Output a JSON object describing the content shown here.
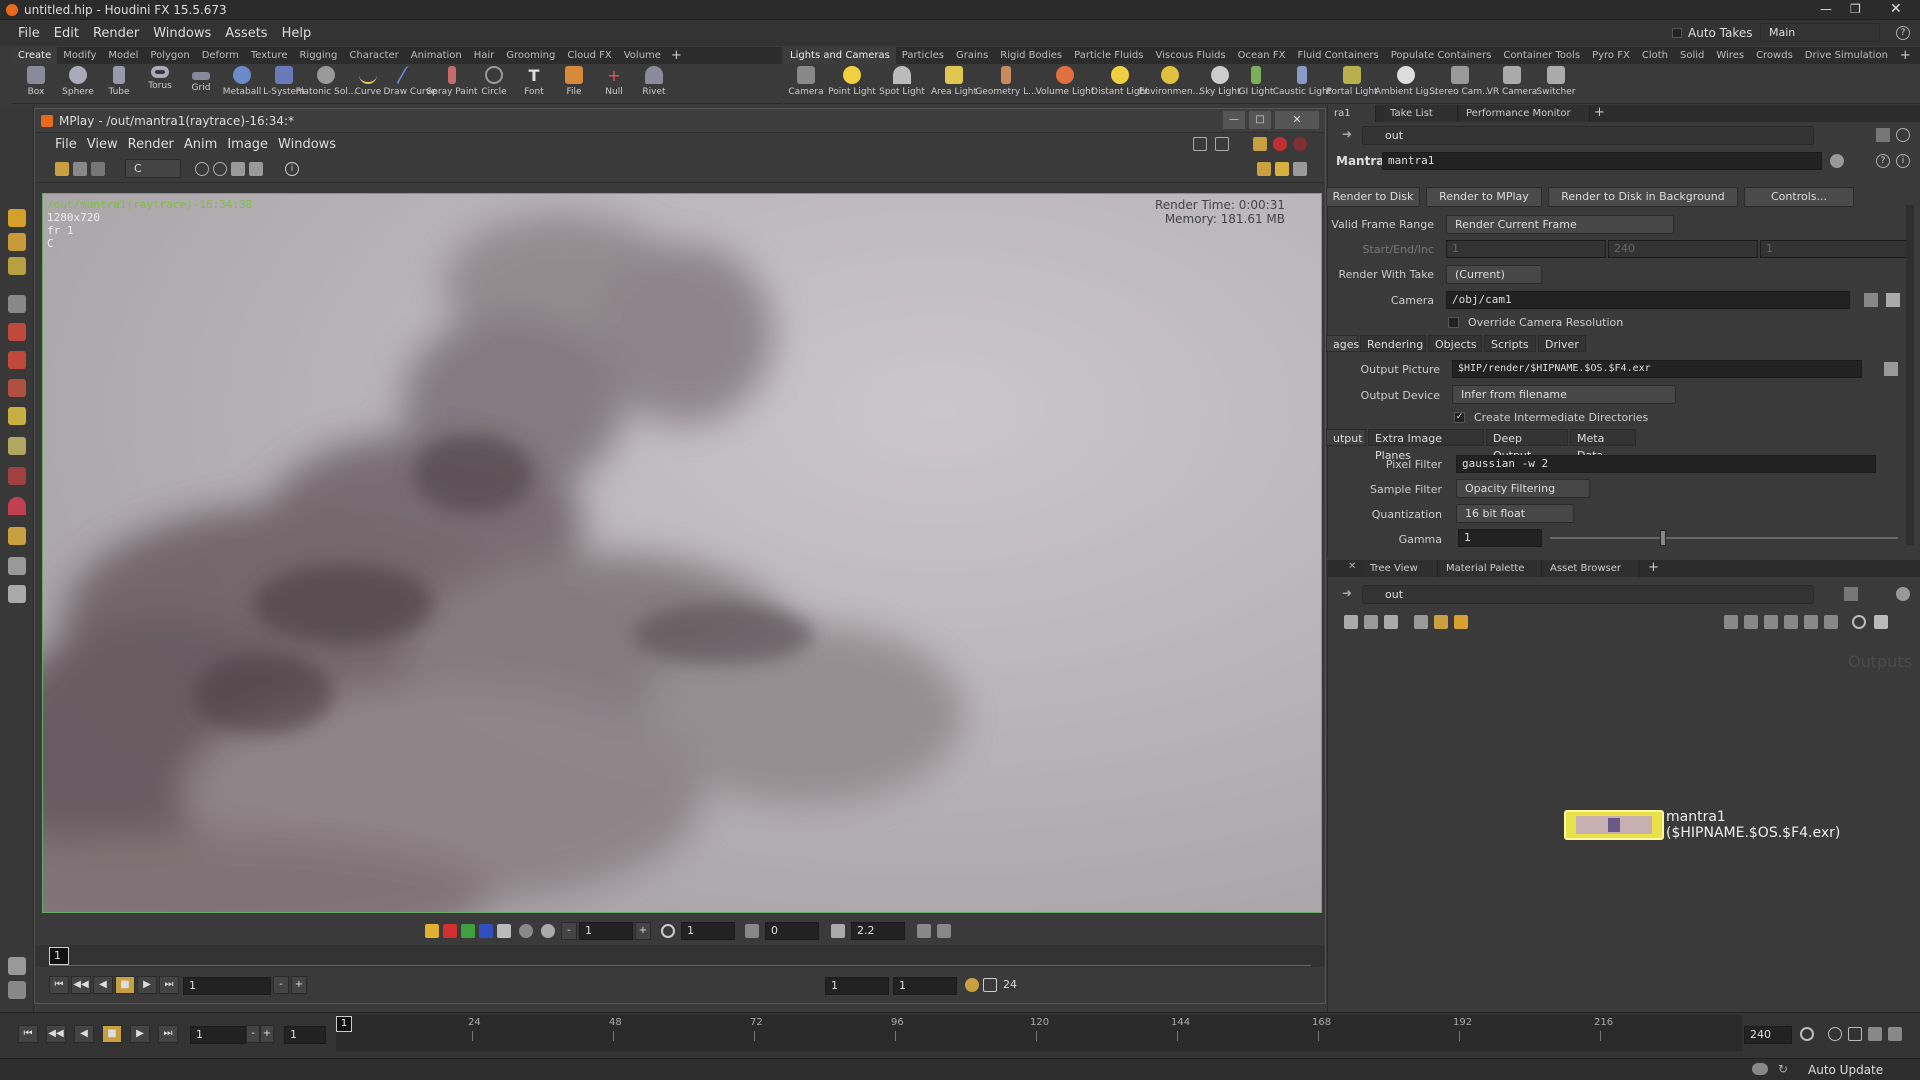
{
  "app": {
    "title": "untitled.hip - Houdini FX 15.5.673"
  },
  "menubar": {
    "items": [
      "File",
      "Edit",
      "Render",
      "Windows",
      "Assets",
      "Help"
    ],
    "auto_takes": "Auto Takes",
    "desktop": "Main"
  },
  "shelf_left": {
    "tabs": [
      "Create",
      "Modify",
      "Model",
      "Polygon",
      "Deform",
      "Texture",
      "Rigging",
      "Character",
      "Animation",
      "Hair",
      "Grooming",
      "Cloud FX",
      "Volume"
    ],
    "tools": [
      "Box",
      "Sphere",
      "Tube",
      "Torus",
      "Grid",
      "Metaball",
      "L-System",
      "Platonic Sol...",
      "Curve",
      "Draw Curve",
      "Spray Paint",
      "Circle",
      "Font",
      "File",
      "Null",
      "Rivet"
    ]
  },
  "shelf_right": {
    "tabs": [
      "Lights and Cameras",
      "Particles",
      "Grains",
      "Rigid Bodies",
      "Particle Fluids",
      "Viscous Fluids",
      "Ocean FX",
      "Fluid Containers",
      "Populate Containers",
      "Container Tools",
      "Pyro FX",
      "Cloth",
      "Solid",
      "Wires",
      "Crowds",
      "Drive Simulation"
    ],
    "tools": [
      "Camera",
      "Point Light",
      "Spot Light",
      "Area Light",
      "Geometry L...",
      "Volume Light",
      "Distant Light",
      "Environmen...",
      "Sky Light",
      "GI Light",
      "Caustic Light",
      "Portal Light",
      "Ambient Lig...",
      "Stereo Cam...",
      "VR Camera",
      "Switcher"
    ]
  },
  "mplay": {
    "title": "MPlay - /out/mantra1(raytrace)-16:34:*",
    "menu": [
      "File",
      "View",
      "Render",
      "Anim",
      "Image",
      "Windows"
    ],
    "channel": "C",
    "overlay": {
      "path": "/out/mantra1(raytrace)-16:34:38",
      "resolution": "1280x720",
      "frame": "fr 1",
      "channel": "C",
      "render_time": "Render Time: 0:00:31",
      "memory": "Memory:   181.61 MB"
    },
    "controls": {
      "exposure": "1",
      "gamma_val": "1",
      "offset": "0",
      "gamma": "2.2"
    },
    "frame_marker": "1",
    "playbar": {
      "frame": "1",
      "start": "1",
      "end": "1",
      "fps": "24"
    }
  },
  "param_panel": {
    "tabs": [
      "ra1",
      "Take List",
      "Performance Monitor"
    ],
    "path": "out",
    "node_type": "Mantra",
    "node_name": "mantra1",
    "buttons": [
      "Render to Disk",
      "Render to MPlay",
      "Render to Disk in Background",
      "Controls..."
    ],
    "valid_frame_range_label": "Valid Frame Range",
    "valid_frame_range": "Render Current Frame",
    "start_end_inc_label": "Start/End/Inc",
    "start": "1",
    "end": "240",
    "inc": "1",
    "render_with_take_label": "Render With Take",
    "render_with_take": "(Current)",
    "camera_label": "Camera",
    "camera": "/obj/cam1",
    "override_res": "Override Camera Resolution",
    "main_tabs": [
      "ages",
      "Rendering",
      "Objects",
      "Scripts",
      "Driver"
    ],
    "output_picture_label": "Output Picture",
    "output_picture": "$HIP/render/$HIPNAME.$OS.$F4.exr",
    "output_device_label": "Output Device",
    "output_device": "Infer from filename",
    "create_dirs": "Create Intermediate Directories",
    "sub_tabs": [
      "utput",
      "Extra Image Planes",
      "Deep Output",
      "Meta Data"
    ],
    "pixel_filter_label": "Pixel Filter",
    "pixel_filter": "gaussian -w 2",
    "sample_filter_label": "Sample Filter",
    "sample_filter": "Opacity Filtering",
    "quantization_label": "Quantization",
    "quantization": "16 bit float",
    "gamma_label": "Gamma",
    "gamma": "1"
  },
  "network_panel": {
    "tabs": [
      "Tree View",
      "Material Palette",
      "Asset Browser"
    ],
    "path": "out",
    "context_label": "Outputs",
    "node_name": "mantra1",
    "node_sub": "($HIPNAME.$OS.$F4.exr)"
  },
  "timeline": {
    "ticks": [
      "24",
      "48",
      "72",
      "96",
      "120",
      "144",
      "168",
      "192",
      "216"
    ],
    "current": "1",
    "start_frame": "1",
    "range_start": "1",
    "range_end": "240",
    "end_field": "240"
  },
  "status": {
    "auto_update": "Auto Update"
  },
  "colors": {
    "accent_green": "#7fbf3f",
    "node_yellow": "#e8e24a",
    "viewport_bg": "#b9b6b8"
  }
}
